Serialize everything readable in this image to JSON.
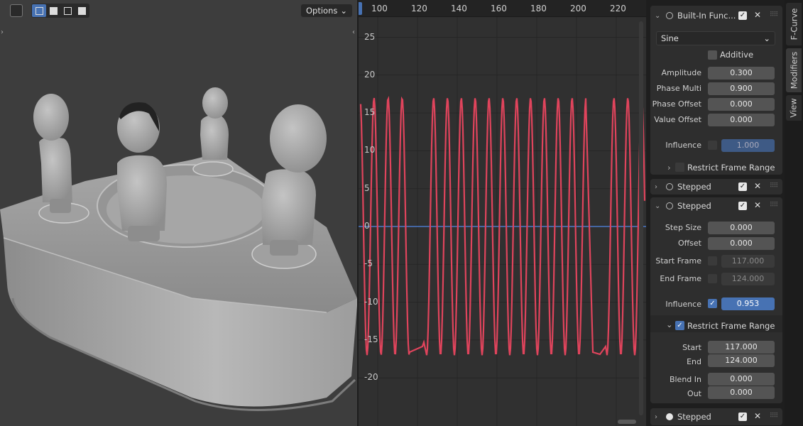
{
  "viewport": {
    "options_label": "Options",
    "options_chevron": "chevron-down-icon"
  },
  "graph": {
    "ruler_labels": [
      "100",
      "120",
      "140",
      "160",
      "180",
      "200",
      "220"
    ],
    "y_labels": [
      "25",
      "20",
      "15",
      "10",
      "5",
      "0",
      "-5",
      "-10",
      "-15",
      "-20"
    ],
    "curve_color": "#e0445c",
    "zero_line_color": "#4a78c8"
  },
  "sidebar": {
    "builtin": {
      "title": "Built-In Func...",
      "function_type": "Sine",
      "additive_label": "Additive",
      "amplitude_label": "Amplitude",
      "amplitude": "0.300",
      "phase_multi_label": "Phase Multi",
      "phase_multi": "0.900",
      "phase_offset_label": "Phase Offset",
      "phase_offset": "0.000",
      "value_offset_label": "Value Offset",
      "value_offset": "0.000",
      "influence_label": "Influence",
      "influence": "1.000",
      "restrict_label": "Restrict Frame Range"
    },
    "stepped1": {
      "title": "Stepped"
    },
    "stepped2": {
      "title": "Stepped",
      "step_size_label": "Step Size",
      "step_size": "0.000",
      "offset_label": "Offset",
      "offset": "0.000",
      "start_frame_label": "Start Frame",
      "start_frame": "117.000",
      "end_frame_label": "End Frame",
      "end_frame": "124.000",
      "influence_label": "Influence",
      "influence": "0.953",
      "restrict_label": "Restrict Frame Range",
      "start_label": "Start",
      "start": "117.000",
      "end_label": "End",
      "end": "124.000",
      "blend_in_label": "Blend In",
      "blend_in": "0.000",
      "out_label": "Out",
      "out": "0.000"
    },
    "stepped3": {
      "title": "Stepped"
    }
  },
  "tabs": [
    "F-Curve",
    "Modifiers",
    "View"
  ],
  "colors": {
    "accent": "#4772b3",
    "panel": "#2e2e2e"
  }
}
